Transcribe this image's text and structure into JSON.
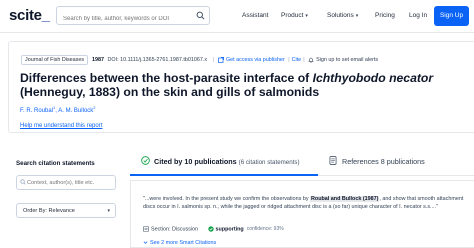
{
  "nav": {
    "logo_main": "scite",
    "logo_suffix": "_",
    "search_placeholder": "Search by title, author, keywords or DOI",
    "items": [
      {
        "label": "Assistant",
        "has_caret": false
      },
      {
        "label": "Product",
        "has_caret": true
      },
      {
        "label": "Solutions",
        "has_caret": true
      },
      {
        "label": "Pricing",
        "has_caret": false
      },
      {
        "label": "Log In",
        "has_caret": false
      }
    ],
    "signup_label": "Sign Up",
    "caret": "▾"
  },
  "article": {
    "journal": "Journal of Fish Diseases",
    "year": "1987",
    "doi": "DOI: 10.1111/j.1365-2761.1987.tb01067.x",
    "access_link": "Get access via publisher",
    "cite_link": "Cite",
    "alerts_label": "Sign up to set email alerts",
    "title_pre": "Differences between the host-parasite interface of ",
    "title_italic": "Ichthyobodo necator",
    "title_post": " (Henneguy, 1883) on the skin and gills of salmonids",
    "authors": [
      {
        "name": "F. R. Roubal",
        "sup": "1"
      },
      {
        "name": "A. M. Bullock",
        "sup": "2"
      }
    ],
    "help_link": "Help me understand this report"
  },
  "sidebar": {
    "title": "Search citation statements",
    "filter_placeholder": "Context, author(s), title etc.",
    "order_label": "Order By: Relevance"
  },
  "tabs": {
    "cited_by": "Cited by 10 publications",
    "cited_by_sub": "(6 citation statements)",
    "references": "References 8 publications"
  },
  "citation": {
    "quote_pre": "\"...were involved. In the present study we confirm the observations by ",
    "quote_highlight": "Roubal and Bullock (1987)",
    "quote_post": ", and show that smooth attachment discs occur in I. salmonis sp. n., while the jagged or ridged attachment disc is a (so far) unique character of I. necator s.s....\"",
    "section": "Section: Discussion",
    "tag": "supporting",
    "confidence": "confidence: 93%",
    "more_link": "See 2 more Smart Citations"
  },
  "colors": {
    "accent": "#0b63f6",
    "supporting": "#16a34a"
  }
}
